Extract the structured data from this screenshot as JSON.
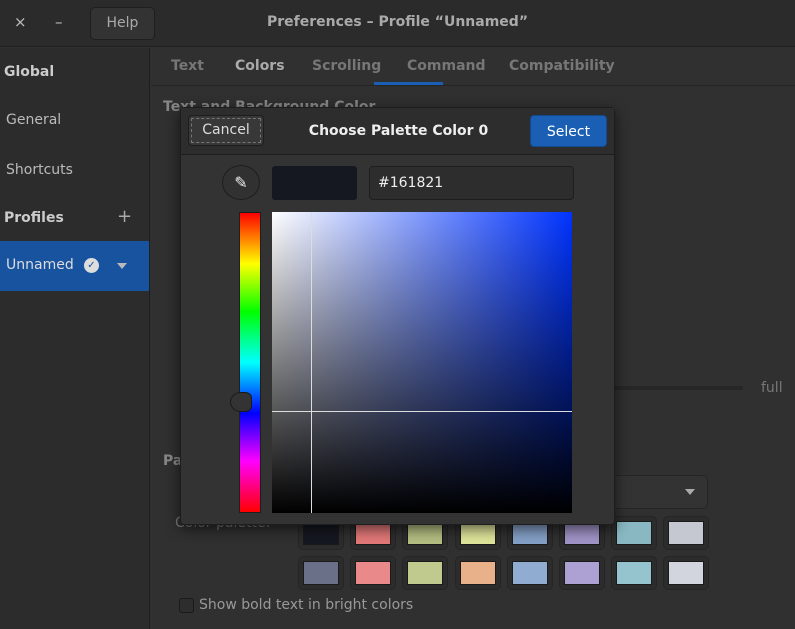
{
  "window": {
    "close": "×",
    "minimize": "–",
    "help": "Help",
    "title": "Preferences – Profile “Unnamed”"
  },
  "sidebar": {
    "global": "Global",
    "general": "General",
    "shortcuts": "Shortcuts",
    "profiles": "Profiles",
    "add": "+",
    "profile": "Unnamed"
  },
  "tabs": [
    "Text",
    "Colors",
    "Scrolling",
    "Command",
    "Compatibility"
  ],
  "content": {
    "section1": "Text and Background Color",
    "section2": "Palette",
    "color_palette_label": "Color palette:",
    "full": "full",
    "bold_bright": "Show bold text in bright colors"
  },
  "dialog": {
    "cancel": "Cancel",
    "title": "Choose Palette Color 0",
    "select": "Select",
    "hex": "#161821",
    "eyedropper": "✎"
  },
  "palette": {
    "row1": [
      "#161821",
      "#e27878",
      "#b4be82",
      "#dfe49a",
      "#84a0c6",
      "#a093c7",
      "#89b8c2",
      "#c6c8d1"
    ],
    "row2": [
      "#6b7089",
      "#e98989",
      "#c0ca8e",
      "#e9b189",
      "#91acd1",
      "#ada0d3",
      "#95c4ce",
      "#d2d4de"
    ]
  }
}
